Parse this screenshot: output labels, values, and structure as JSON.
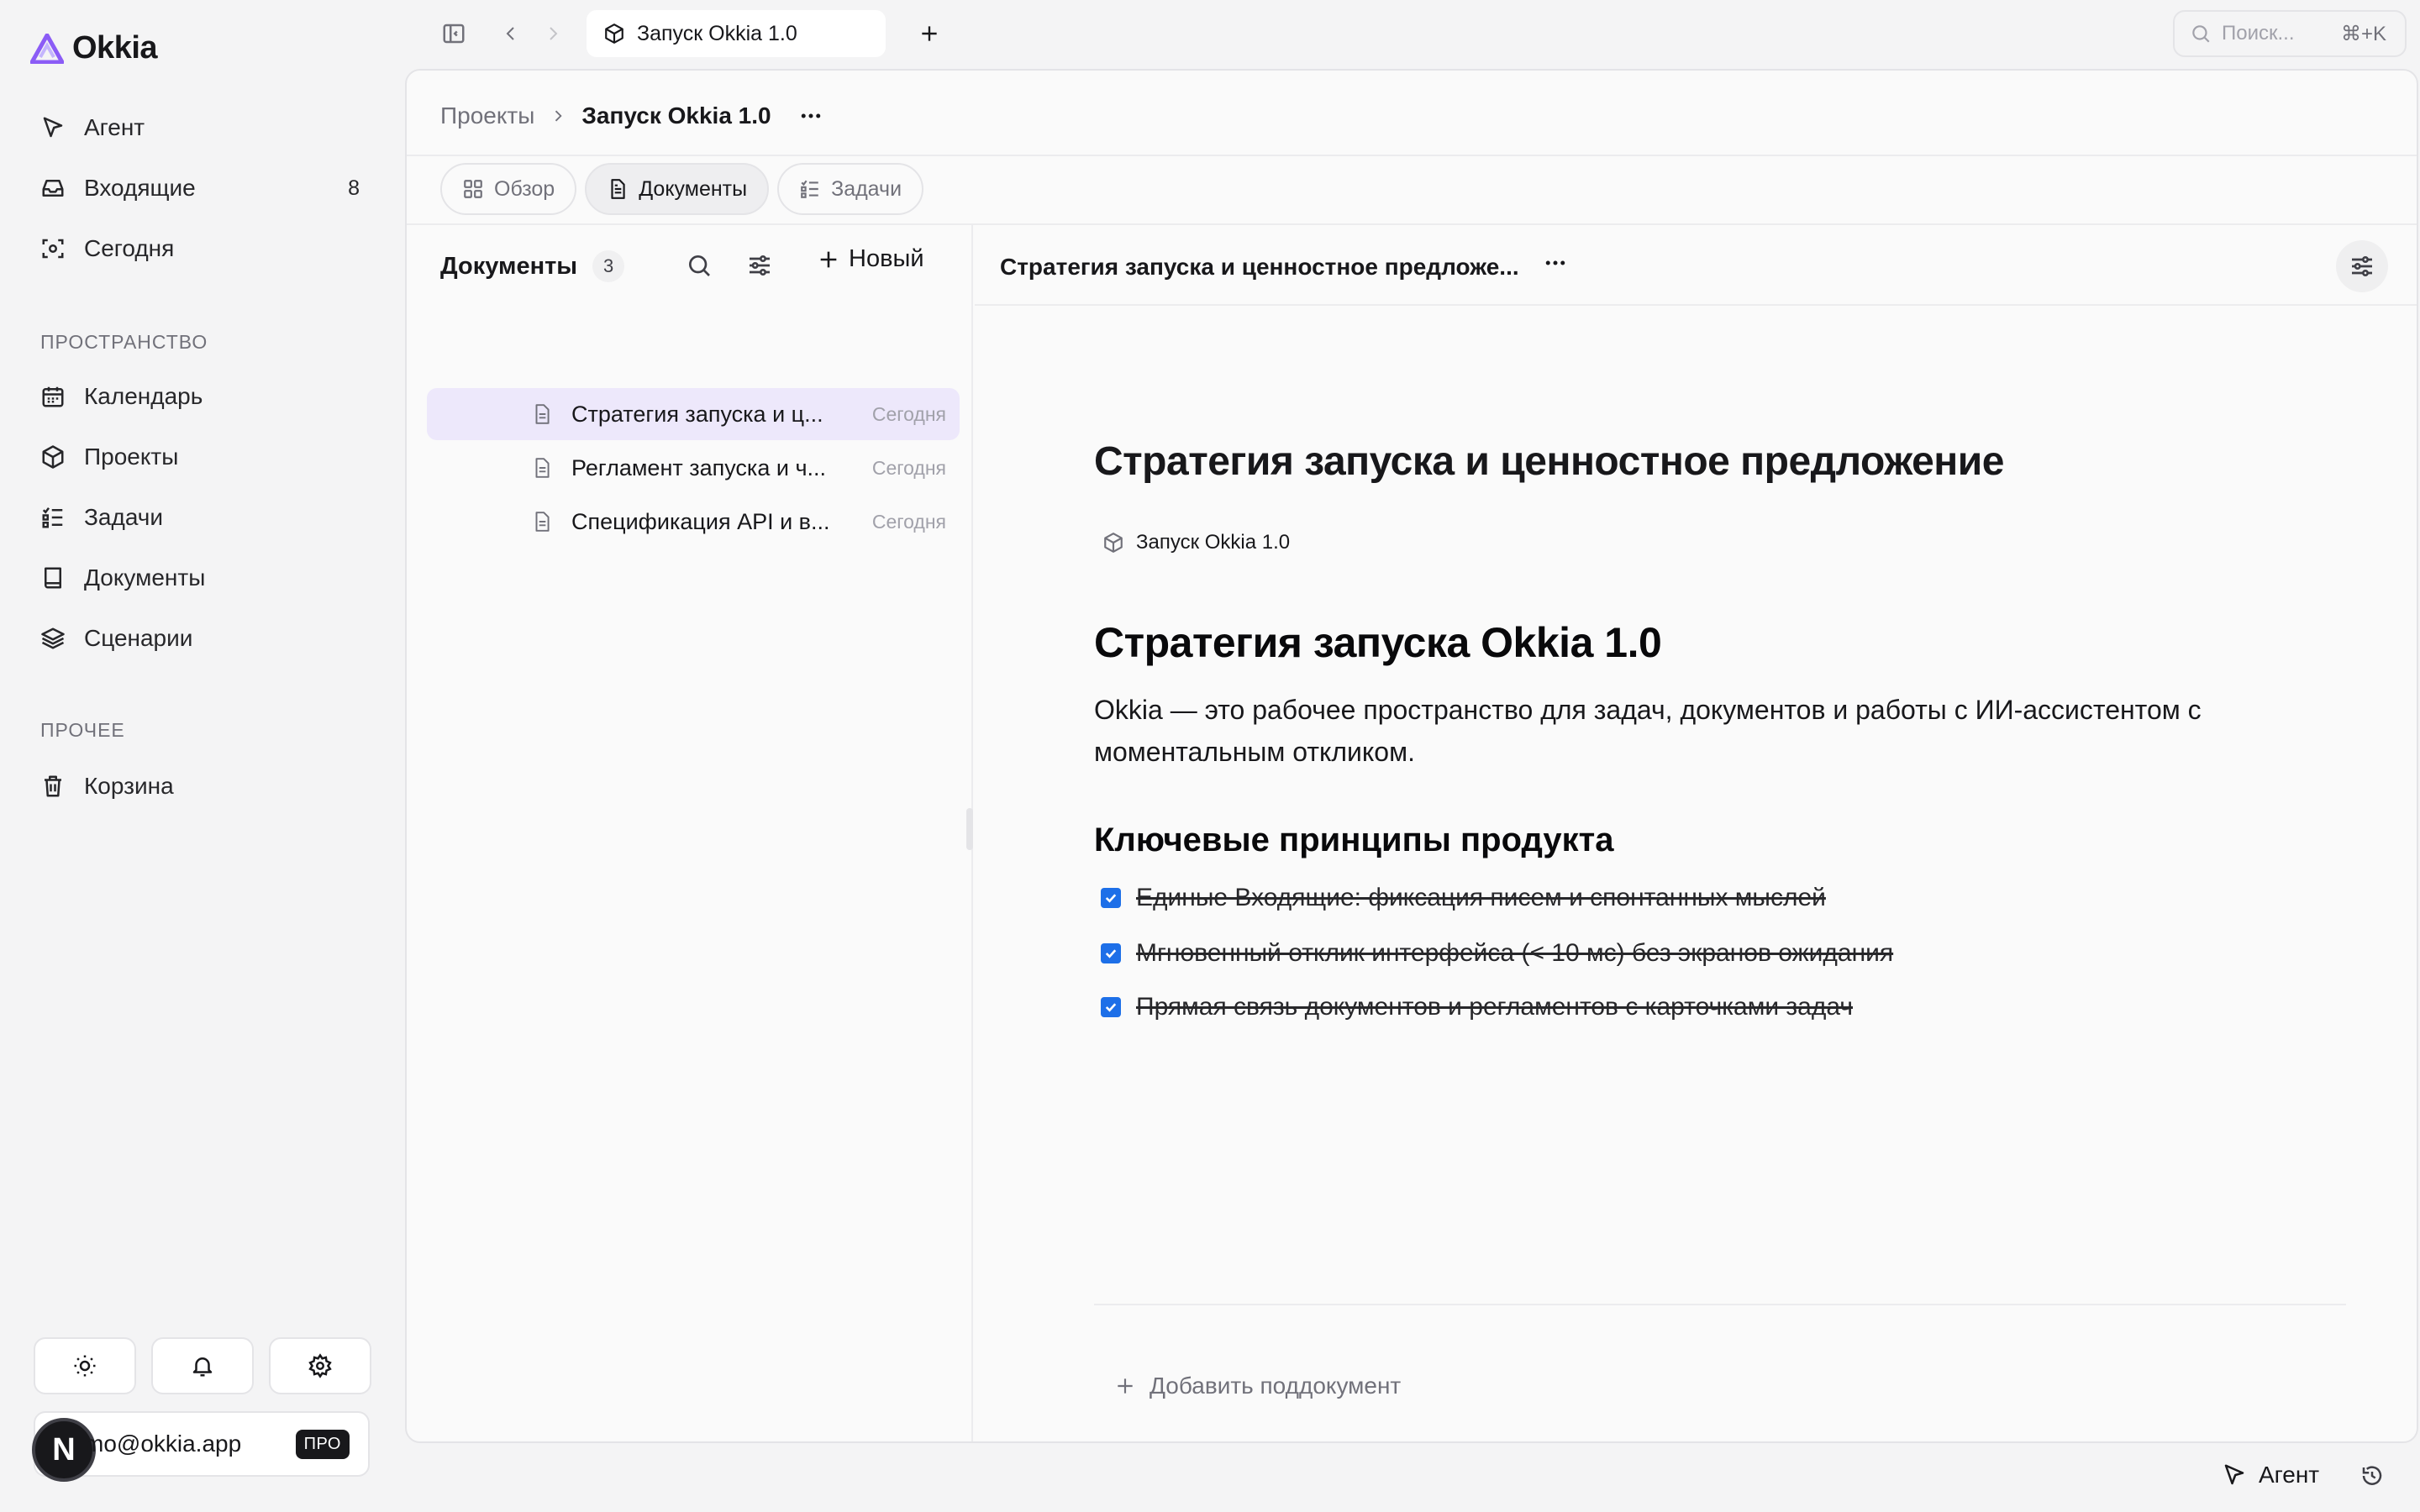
{
  "app": {
    "name": "Okkia",
    "brand_color": "#8b5cf6"
  },
  "sidebar": {
    "items": [
      {
        "label": "Агент",
        "icon": "cursor-arrow-icon"
      },
      {
        "label": "Входящие",
        "icon": "inbox-icon",
        "badge": "8"
      },
      {
        "label": "Сегодня",
        "icon": "focus-icon"
      }
    ],
    "section_space": "ПРОСТРАНСТВО",
    "space_items": [
      {
        "label": "Календарь",
        "icon": "calendar-icon"
      },
      {
        "label": "Проекты",
        "icon": "cube-icon"
      },
      {
        "label": "Задачи",
        "icon": "task-list-icon"
      },
      {
        "label": "Документы",
        "icon": "book-icon"
      },
      {
        "label": "Сценарии",
        "icon": "layers-icon"
      }
    ],
    "section_other": "ПРОЧЕЕ",
    "other_items": [
      {
        "label": "Корзина",
        "icon": "trash-icon"
      }
    ],
    "user": {
      "avatar_letter": "N",
      "email": "demo@okkia.app",
      "email_visible": "mo@okkia.app",
      "plan": "ПРО"
    }
  },
  "topbar": {
    "tab_title": "Запуск Okkia 1.0",
    "search_placeholder": "Поиск...",
    "search_shortcut": "⌘+K"
  },
  "breadcrumb": {
    "root": "Проекты",
    "current": "Запуск Okkia 1.0"
  },
  "tabs": [
    {
      "label": "Обзор",
      "active": false
    },
    {
      "label": "Документы",
      "active": true
    },
    {
      "label": "Задачи",
      "active": false
    }
  ],
  "doc_list": {
    "title": "Документы",
    "count": "3",
    "new_label": "Новый",
    "rows": [
      {
        "title": "Стратегия запуска и ц...",
        "date": "Сегодня",
        "active": true
      },
      {
        "title": "Регламент запуска и ч...",
        "date": "Сегодня",
        "active": false
      },
      {
        "title": "Спецификация API и в...",
        "date": "Сегодня",
        "active": false
      }
    ]
  },
  "document": {
    "header_title": "Стратегия запуска и ценностное предложе...",
    "title": "Стратегия запуска и ценностное предложение",
    "project_chip": "Запуск Okkia 1.0",
    "h2": "Стратегия запуска Okkia 1.0",
    "paragraph": "Okkia — это рабочее пространство для задач, документов и работы с ИИ-ассистентом с моментальным откликом.",
    "h3": "Ключевые принципы продукта",
    "checklist": [
      {
        "text": "Единые Входящие: фиксация писем и спонтанных мыслей",
        "checked": true
      },
      {
        "text": "Мгновенный отклик интерфейса (< 10 мс) без экранов ожидания",
        "checked": true
      },
      {
        "text": "Прямая связь документов и регламентов с карточками задач",
        "checked": true
      }
    ],
    "add_subdoc": "Добавить поддокумент"
  },
  "footer": {
    "agent_label": "Агент"
  }
}
